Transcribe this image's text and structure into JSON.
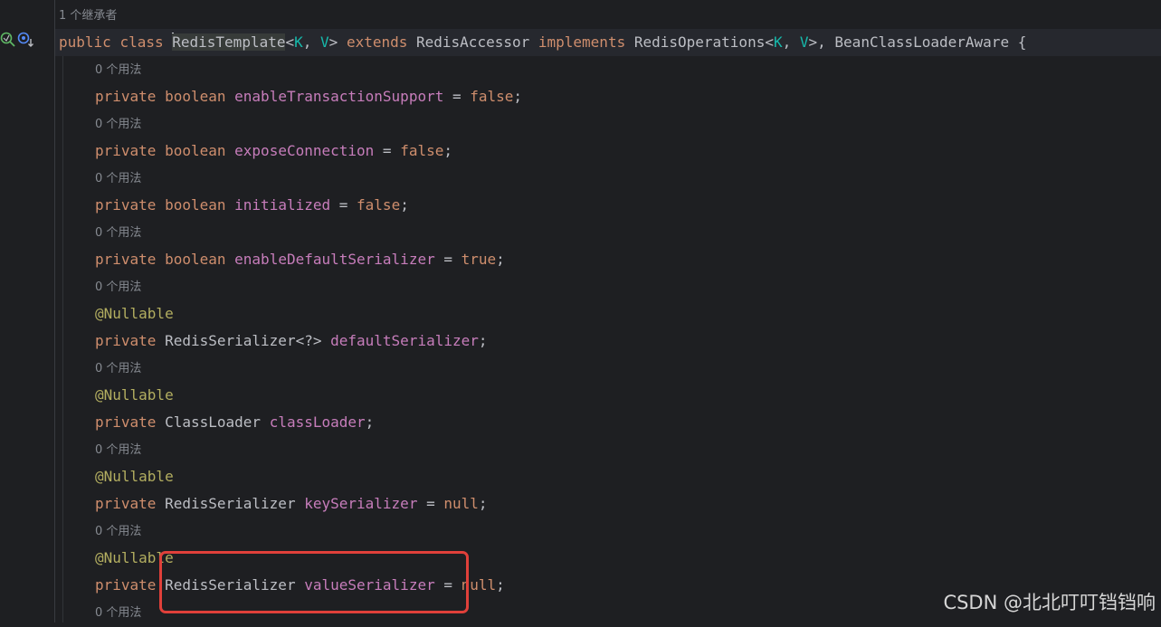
{
  "colors": {
    "background": "#1e1f22",
    "keyword": "#cf8e6d",
    "type_param": "#16baac",
    "field": "#c77dbb",
    "annotation": "#b3ae60",
    "text": "#bcbec4",
    "hint": "#868a91",
    "highlight_box": "#e0403a"
  },
  "gutter": {
    "icons": [
      "inheritor-search-icon",
      "implements-arrow-icon"
    ]
  },
  "editor": {
    "class_hint": "1 个继承者",
    "usage_hint": "0 个用法",
    "class_decl": {
      "kw_public": "public",
      "kw_class": "class",
      "class_name": "RedisTemplate",
      "lt": "<",
      "tp_k": "K",
      "comma1": ", ",
      "tp_v": "V",
      "gt": "> ",
      "kw_extends": "extends",
      "base": " RedisAccessor ",
      "kw_implements": "implements",
      "iface": " RedisOperations<",
      "tp_k2": "K",
      "comma2": ", ",
      "tp_v2": "V",
      "rest": ">, BeanClassLoaderAware {"
    },
    "kw_private": "private",
    "kw_boolean": "boolean",
    "annotation": "@Nullable",
    "fields": {
      "f1": {
        "name": "enableTransactionSupport",
        "assign": " = ",
        "value": "false",
        "end": ";"
      },
      "f2": {
        "name": "exposeConnection",
        "assign": " = ",
        "value": "false",
        "end": ";"
      },
      "f3": {
        "name": "initialized",
        "assign": " = ",
        "value": "false",
        "end": ";"
      },
      "f4": {
        "name": "enableDefaultSerializer",
        "assign": " = ",
        "value": "true",
        "end": ";"
      },
      "f5": {
        "type": "RedisSerializer<?>",
        "name": "defaultSerializer",
        "end": ";"
      },
      "f6": {
        "type": "ClassLoader",
        "name": "classLoader",
        "end": ";"
      },
      "f7": {
        "type": "RedisSerializer",
        "name": "keySerializer",
        "assign": " = ",
        "value": "null",
        "end": ";"
      },
      "f8": {
        "type": "RedisSerializer",
        "name": "valueSerializer",
        "assign": " = ",
        "value": "null",
        "end": ";"
      }
    }
  },
  "watermark": "CSDN @北北叮叮铛铛响"
}
